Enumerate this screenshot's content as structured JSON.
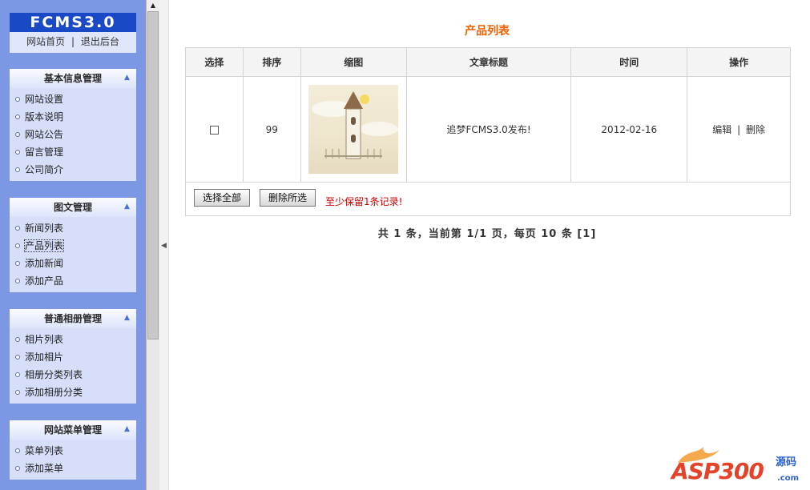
{
  "sidebar": {
    "logo": "FCMS3.0",
    "links": {
      "home": "网站首页",
      "separator": "|",
      "logout": "退出后台"
    },
    "panels": [
      {
        "title": "基本信息管理",
        "items": [
          "网站设置",
          "版本说明",
          "网站公告",
          "留言管理",
          "公司简介"
        ]
      },
      {
        "title": "图文管理",
        "items": [
          "新闻列表",
          "产品列表",
          "添加新闻",
          "添加产品"
        ]
      },
      {
        "title": "普通相册管理",
        "items": [
          "相片列表",
          "添加相片",
          "相册分类列表",
          "添加相册分类"
        ]
      },
      {
        "title": "网站菜单管理",
        "items": [
          "菜单列表",
          "添加菜单"
        ]
      }
    ],
    "active_item": "产品列表"
  },
  "main": {
    "title": "产品列表",
    "table": {
      "headers": [
        "选择",
        "排序",
        "缩图",
        "文章标题",
        "时间",
        "操作"
      ],
      "rows": [
        {
          "order": "99",
          "article_title": "追梦FCMS3.0发布!",
          "date": "2012-02-16",
          "edit_label": "编辑",
          "action_separator": "|",
          "delete_label": "删除"
        }
      ]
    },
    "buttons": {
      "select_all": "选择全部",
      "delete_selected": "删除所选"
    },
    "warning": "至少保留1条记录!",
    "pager": "共 1 条，当前第 1/1 页，每页 10 条 [1]"
  },
  "watermark": {
    "brand": "ASP300",
    "cn": "源码",
    "domain": ".com"
  },
  "colors": {
    "sidebar_bg": "#7c98e4",
    "logo_bg": "#1a49c6",
    "title_orange": "#f06000",
    "warning_red": "#cc0000"
  },
  "icons": {
    "panel_toggle": "chevron-up-icon",
    "bullet": "circle-bullet-icon",
    "thumbnail": "tower-image"
  }
}
